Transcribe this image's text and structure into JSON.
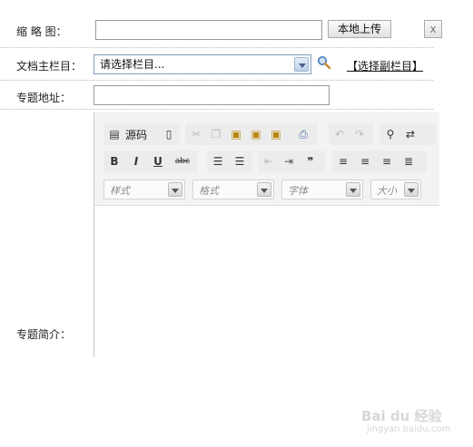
{
  "form": {
    "thumbnail": {
      "label": "缩 略 图：",
      "value": "",
      "upload_btn": "本地上传",
      "extra_btn": "x"
    },
    "main_column": {
      "label": "文档主栏目：",
      "selected": "请选择栏目...",
      "sub_link": "【选择副栏目】"
    },
    "topic_url": {
      "label": "专题地址：",
      "value": ""
    },
    "topic_intro": {
      "label": "专题简介："
    }
  },
  "editor": {
    "source_label": "源码",
    "combos": {
      "style": "样式",
      "format": "格式",
      "font": "字体",
      "size": "大小"
    },
    "icons": [
      "source-icon",
      "new-page-icon",
      "cut-icon",
      "copy-icon",
      "paste-icon",
      "paste-text-icon",
      "paste-word-icon",
      "print-icon",
      "undo-icon",
      "redo-icon",
      "find-icon",
      "replace-icon",
      "bold-icon",
      "italic-icon",
      "underline-icon",
      "strikethrough-icon",
      "numbered-list-icon",
      "bulleted-list-icon",
      "outdent-icon",
      "indent-icon",
      "blockquote-icon",
      "align-left-icon",
      "align-center-icon",
      "align-right-icon",
      "justify-icon",
      "search-icon"
    ]
  },
  "watermark": {
    "text": "Bai du 经验",
    "url": "jingyan.baidu.com"
  }
}
